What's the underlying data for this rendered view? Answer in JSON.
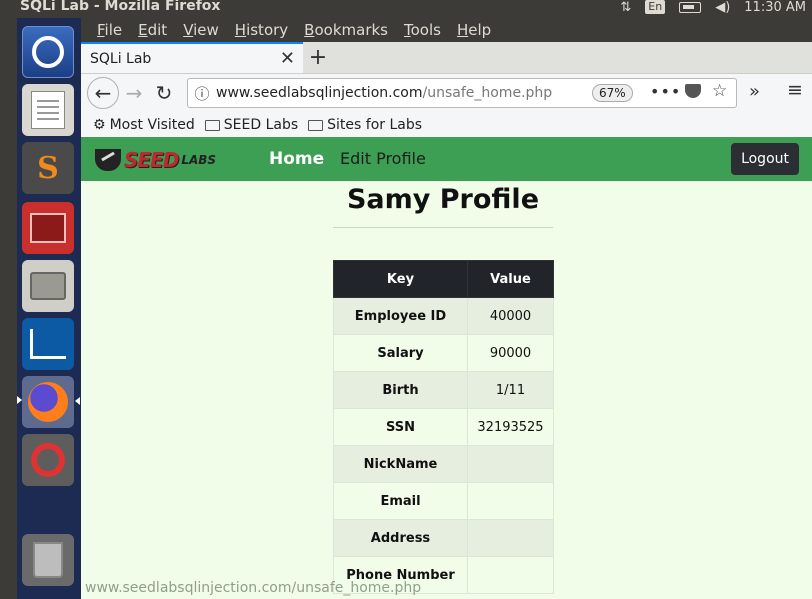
{
  "window": {
    "title": "SQLi Lab - Mozilla Firefox",
    "keyboard_layout": "En",
    "clock": "11:30 AM",
    "tray_icons": [
      "network-transfer-icon",
      "battery-icon",
      "volume-icon"
    ]
  },
  "launcher": {
    "items": [
      "dash-icon",
      "text-editor-icon",
      "sublime-icon",
      "terminal-icon",
      "files-icon",
      "wireshark-icon",
      "firefox-icon",
      "settings-icon",
      "trash-icon"
    ]
  },
  "menubar": {
    "items": [
      {
        "label": "File",
        "accel": "F",
        "rest": "ile"
      },
      {
        "label": "Edit",
        "accel": "E",
        "rest": "dit"
      },
      {
        "label": "View",
        "accel": "V",
        "rest": "iew"
      },
      {
        "label": "History",
        "accel": "H",
        "rest": "istory"
      },
      {
        "label": "Bookmarks",
        "accel": "B",
        "rest": "ookmarks"
      },
      {
        "label": "Tools",
        "accel": "T",
        "rest": "ools"
      },
      {
        "label": "Help",
        "accel": "H",
        "rest": "elp"
      }
    ]
  },
  "tabs": [
    {
      "label": "SQLi Lab"
    }
  ],
  "urlbar": {
    "host": "www.seedlabsqlinjection.com",
    "path": "/unsafe_home.php",
    "zoom": "67%"
  },
  "bookmarks": [
    {
      "label": "Most Visited",
      "icon": "gear-icon"
    },
    {
      "label": "SEED Labs",
      "icon": "folder-icon"
    },
    {
      "label": "Sites for Labs",
      "icon": "folder-icon"
    }
  ],
  "site": {
    "logo_word": "SEED",
    "logo_suffix": "LABS",
    "nav": {
      "home": "Home",
      "edit_profile": "Edit Profile"
    },
    "logout": "Logout",
    "profile_title": "Samy Profile",
    "table": {
      "headers": {
        "key": "Key",
        "value": "Value"
      },
      "rows": [
        {
          "key": "Employee ID",
          "value": "40000"
        },
        {
          "key": "Salary",
          "value": "90000"
        },
        {
          "key": "Birth",
          "value": "1/11"
        },
        {
          "key": "SSN",
          "value": "32193525"
        },
        {
          "key": "NickName",
          "value": ""
        },
        {
          "key": "Email",
          "value": ""
        },
        {
          "key": "Address",
          "value": ""
        },
        {
          "key": "Phone Number",
          "value": ""
        }
      ]
    }
  },
  "status_bar": {
    "url": "www.seedlabsqlinjection.com/unsafe_home.php"
  }
}
